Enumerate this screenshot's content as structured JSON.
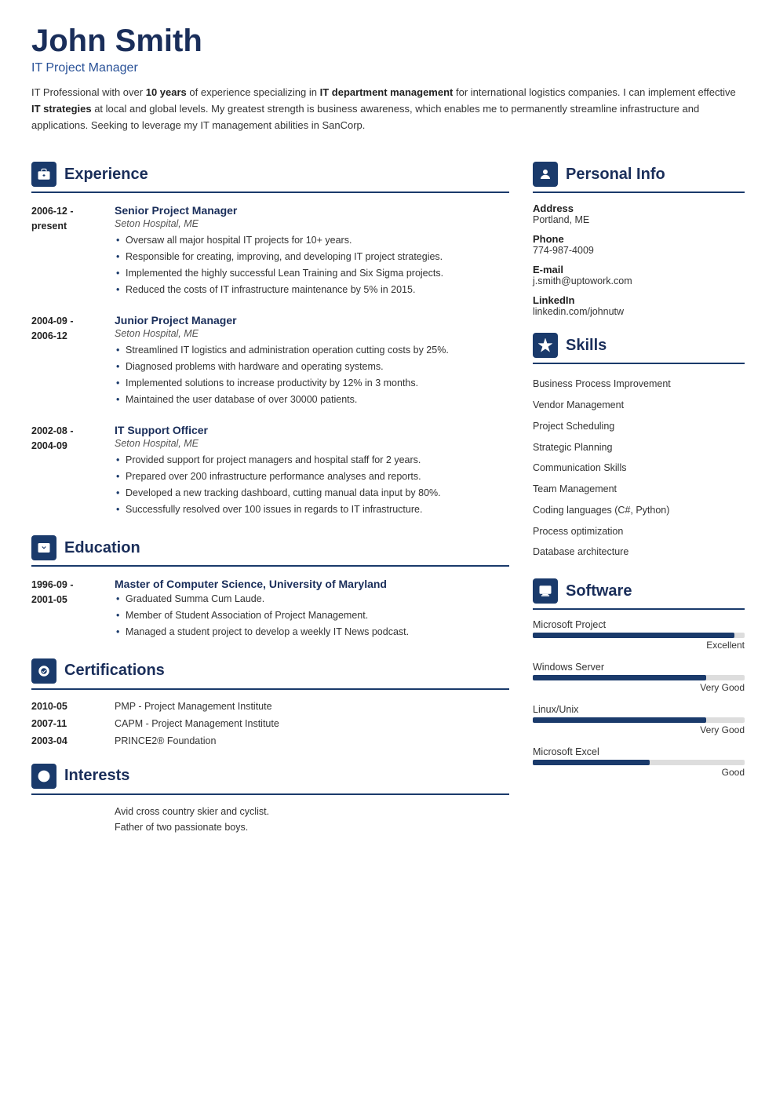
{
  "header": {
    "name": "John Smith",
    "title": "IT Project Manager",
    "summary_parts": [
      {
        "text": "IT Professional with over ",
        "bold": false
      },
      {
        "text": "10 years",
        "bold": true
      },
      {
        "text": " of experience specializing in ",
        "bold": false
      },
      {
        "text": "IT department management",
        "bold": true
      },
      {
        "text": " for international logistics companies. I can implement effective ",
        "bold": false
      },
      {
        "text": "IT strategies",
        "bold": true
      },
      {
        "text": " at local and global levels. My greatest strength is business awareness, which enables me to permanently streamline infrastructure and applications. Seeking to leverage my IT management abilities in SanCorp.",
        "bold": false
      }
    ]
  },
  "sections": {
    "experience": {
      "label": "Experience",
      "entries": [
        {
          "date": "2006-12 -\npresent",
          "title": "Senior Project Manager",
          "subtitle": "Seton Hospital, ME",
          "bullets": [
            "Oversaw all major hospital IT projects for 10+ years.",
            "Responsible for creating, improving, and developing IT project strategies.",
            "Implemented the highly successful Lean Training and Six Sigma projects.",
            "Reduced the costs of IT infrastructure maintenance by 5% in 2015."
          ]
        },
        {
          "date": "2004-09 -\n2006-12",
          "title": "Junior Project Manager",
          "subtitle": "Seton Hospital, ME",
          "bullets": [
            "Streamlined IT logistics and administration operation cutting costs by 25%.",
            "Diagnosed problems with hardware and operating systems.",
            "Implemented solutions to increase productivity by 12% in 3 months.",
            "Maintained the user database of over 30000 patients."
          ]
        },
        {
          "date": "2002-08 -\n2004-09",
          "title": "IT Support Officer",
          "subtitle": "Seton Hospital, ME",
          "bullets": [
            "Provided support for project managers and hospital staff for 2 years.",
            "Prepared over 200 infrastructure performance analyses and reports.",
            "Developed a new tracking dashboard, cutting manual data input by 80%.",
            "Successfully resolved over 100 issues in regards to IT infrastructure."
          ]
        }
      ]
    },
    "education": {
      "label": "Education",
      "entries": [
        {
          "date": "1996-09 -\n2001-05",
          "title": "Master of Computer Science, University of Maryland",
          "subtitle": "",
          "bullets": [
            "Graduated Summa Cum Laude.",
            "Member of Student Association of Project Management.",
            "Managed a student project to develop a weekly IT News podcast."
          ]
        }
      ]
    },
    "certifications": {
      "label": "Certifications",
      "entries": [
        {
          "date": "2010-05",
          "title": "PMP - Project Management Institute"
        },
        {
          "date": "2007-11",
          "title": "CAPM - Project Management Institute"
        },
        {
          "date": "2003-04",
          "title": "PRINCE2® Foundation"
        }
      ]
    },
    "interests": {
      "label": "Interests",
      "items": [
        "Avid cross country skier and cyclist.",
        "Father of two passionate boys."
      ]
    }
  },
  "right": {
    "personal_info": {
      "label": "Personal Info",
      "fields": [
        {
          "label": "Address",
          "value": "Portland, ME"
        },
        {
          "label": "Phone",
          "value": "774-987-4009"
        },
        {
          "label": "E-mail",
          "value": "j.smith@uptowork.com"
        },
        {
          "label": "LinkedIn",
          "value": "linkedin.com/johnutw"
        }
      ]
    },
    "skills": {
      "label": "Skills",
      "items": [
        "Business Process Improvement",
        "Vendor Management",
        "Project Scheduling",
        "Strategic Planning",
        "Communication Skills",
        "Team Management",
        "Coding languages (C#, Python)",
        "Process optimization",
        "Database architecture"
      ]
    },
    "software": {
      "label": "Software",
      "items": [
        {
          "name": "Microsoft Project",
          "percent": 95,
          "label": "Excellent"
        },
        {
          "name": "Windows Server",
          "percent": 82,
          "label": "Very Good"
        },
        {
          "name": "Linux/Unix",
          "percent": 82,
          "label": "Very Good"
        },
        {
          "name": "Microsoft Excel",
          "percent": 55,
          "label": "Good"
        }
      ]
    }
  }
}
